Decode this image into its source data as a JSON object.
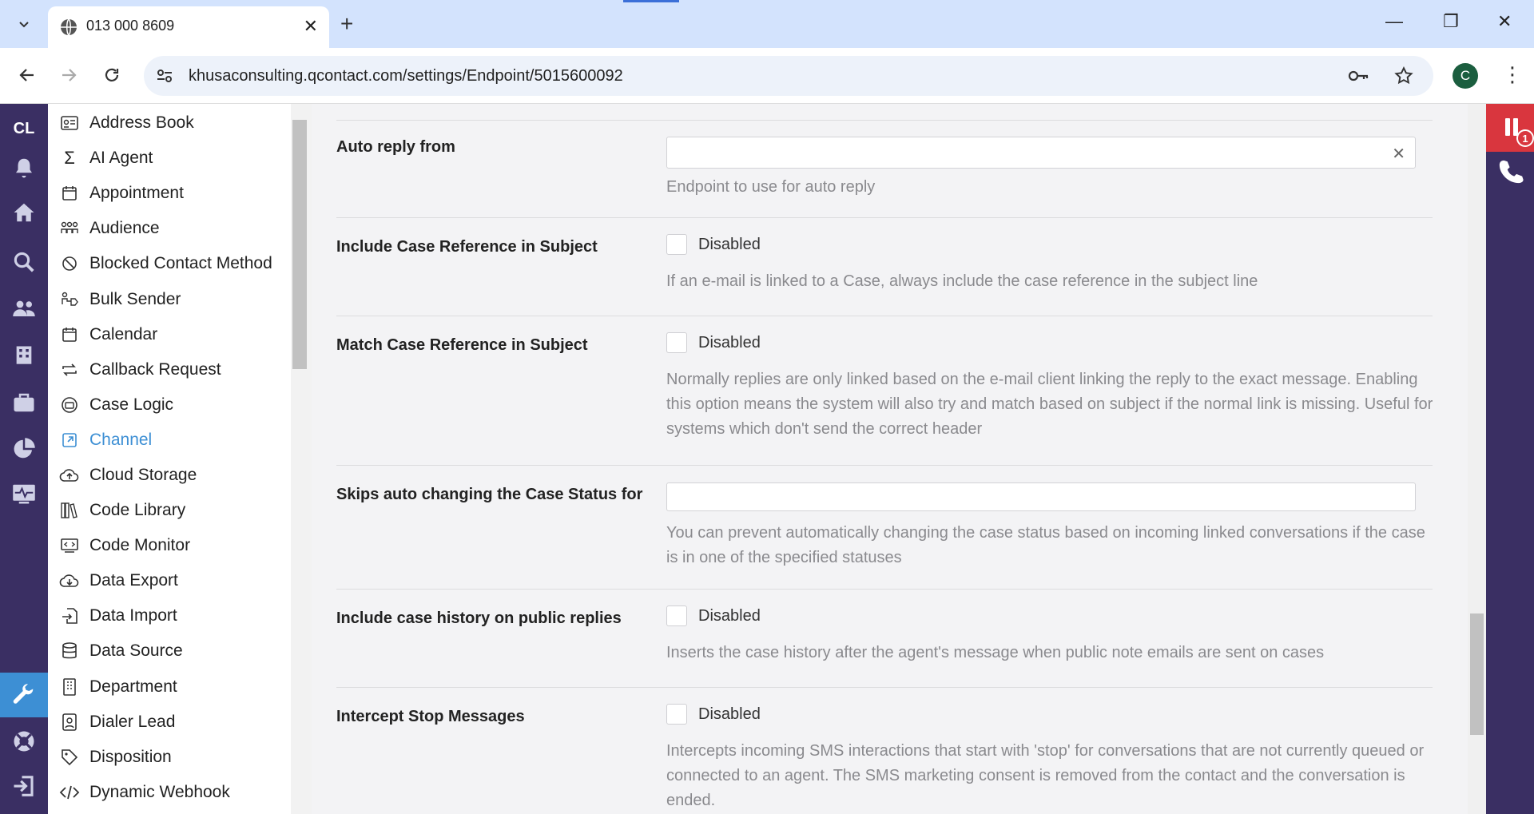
{
  "browser": {
    "tab_title": "013 000 8609",
    "url": "khusaconsulting.qcontact.com/settings/Endpoint/5015600092",
    "profile_initial": "C"
  },
  "rail": {
    "logo": "CL"
  },
  "dock": {
    "badge_count": "1"
  },
  "sidebar": {
    "items": [
      {
        "label": "Address Book",
        "icon": "address-card-icon"
      },
      {
        "label": "AI Agent",
        "icon": "sigma-icon"
      },
      {
        "label": "Appointment",
        "icon": "calendar-icon"
      },
      {
        "label": "Audience",
        "icon": "people-group-icon"
      },
      {
        "label": "Blocked Contact Method",
        "icon": "ban-icon"
      },
      {
        "label": "Bulk Sender",
        "icon": "bulk-sender-icon"
      },
      {
        "label": "Calendar",
        "icon": "calendar-icon"
      },
      {
        "label": "Callback Request",
        "icon": "repeat-icon"
      },
      {
        "label": "Case Logic",
        "icon": "case-logic-icon"
      },
      {
        "label": "Channel",
        "icon": "external-link-icon"
      },
      {
        "label": "Cloud Storage",
        "icon": "cloud-upload-icon"
      },
      {
        "label": "Code Library",
        "icon": "books-icon"
      },
      {
        "label": "Code Monitor",
        "icon": "monitor-code-icon"
      },
      {
        "label": "Data Export",
        "icon": "cloud-download-icon"
      },
      {
        "label": "Data Import",
        "icon": "file-import-icon"
      },
      {
        "label": "Data Source",
        "icon": "database-icon"
      },
      {
        "label": "Department",
        "icon": "building-icon"
      },
      {
        "label": "Dialer Lead",
        "icon": "contact-card-icon"
      },
      {
        "label": "Disposition",
        "icon": "tag-icon"
      },
      {
        "label": "Dynamic Webhook",
        "icon": "code-icon"
      }
    ],
    "active_index": 9
  },
  "settings": {
    "auto_reply": {
      "label": "Auto reply from",
      "value": "",
      "help": "Endpoint to use for auto reply"
    },
    "include_case_ref": {
      "label": "Include Case Reference in Subject",
      "state": "Disabled",
      "help": "If an e-mail is linked to a Case, always include the case reference in the subject line"
    },
    "match_case_ref": {
      "label": "Match Case Reference in Subject",
      "state": "Disabled",
      "help": "Normally replies are only linked based on the e-mail client linking the reply to the exact message. Enabling this option means the system will also try and match based on subject if the normal link is missing. Useful for systems which don't send the correct header"
    },
    "skip_status": {
      "label": "Skips auto changing the Case Status for",
      "value": "",
      "help": "You can prevent automatically changing the case status based on incoming linked conversations if the case is in one of the specified statuses"
    },
    "case_history": {
      "label": "Include case history on public replies",
      "state": "Disabled",
      "help": "Inserts the case history after the agent's message when public note emails are sent on cases"
    },
    "intercept_stop": {
      "label": "Intercept Stop Messages",
      "state": "Disabled",
      "help": "Intercepts incoming SMS interactions that start with 'stop' for conversations that are not currently queued or connected to an agent. The SMS marketing consent is removed from the contact and the conversation is ended."
    }
  }
}
